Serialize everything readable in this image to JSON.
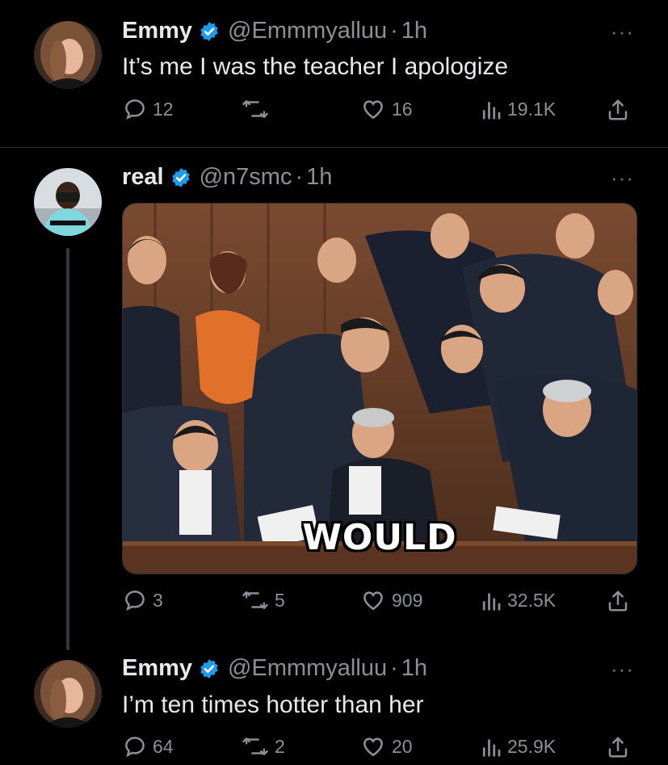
{
  "tweets": [
    {
      "name": "Emmy",
      "handle": "@Emmmyalluu",
      "dot": "·",
      "time": "1h",
      "text": "It’s me I was the teacher I apologize",
      "replies": "12",
      "reposts": "",
      "likes": "16",
      "views": "19.1K"
    },
    {
      "name": "real",
      "handle": "@n7smc",
      "dot": "·",
      "time": "1h",
      "media_caption": "WOULD",
      "replies": "3",
      "reposts": "5",
      "likes": "909",
      "views": "32.5K"
    },
    {
      "name": "Emmy",
      "handle": "@Emmmyalluu",
      "dot": "·",
      "time": "1h",
      "text": "I’m ten times hotter than her",
      "replies": "64",
      "reposts": "2",
      "likes": "20",
      "views": "25.9K"
    }
  ],
  "more_label": "···",
  "colors": {
    "verified": "#1d9bf0",
    "muted": "#8b9096",
    "background": "#000000"
  }
}
